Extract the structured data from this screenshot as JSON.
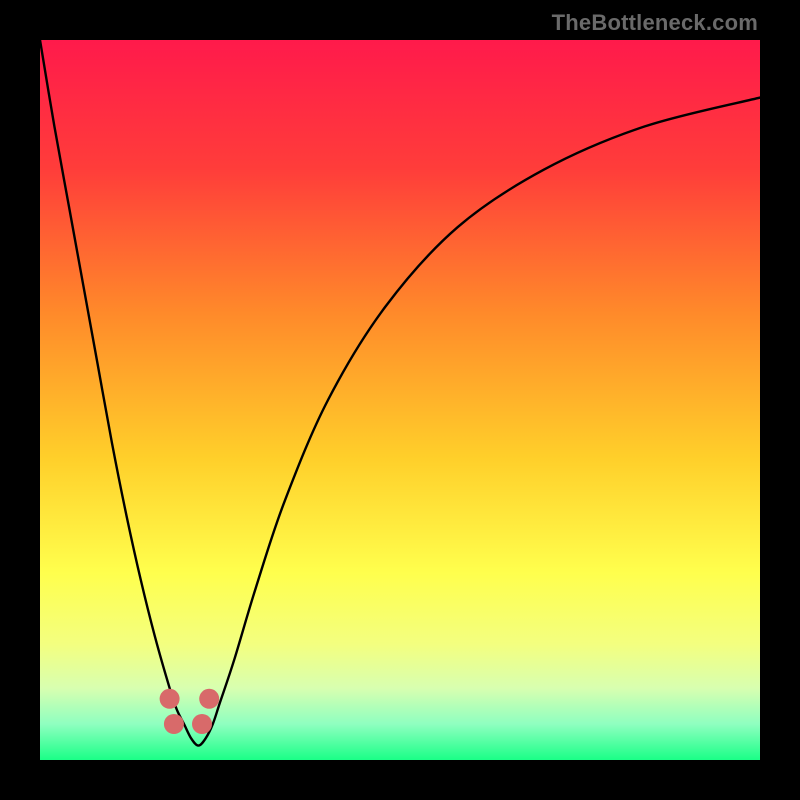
{
  "watermark": "TheBottleneck.com",
  "chart_data": {
    "type": "line",
    "title": "",
    "xlabel": "",
    "ylabel": "",
    "xlim": [
      0,
      100
    ],
    "ylim": [
      0,
      100
    ],
    "legend": false,
    "grid": false,
    "background_gradient_stops": [
      {
        "pct": 0,
        "color": "#ff1a4b"
      },
      {
        "pct": 18,
        "color": "#ff3d3a"
      },
      {
        "pct": 38,
        "color": "#ff8a2a"
      },
      {
        "pct": 58,
        "color": "#ffcf2a"
      },
      {
        "pct": 74,
        "color": "#ffff4d"
      },
      {
        "pct": 84,
        "color": "#f3ff80"
      },
      {
        "pct": 90,
        "color": "#d8ffb0"
      },
      {
        "pct": 95,
        "color": "#8fffc0"
      },
      {
        "pct": 100,
        "color": "#1aff87"
      }
    ],
    "series": [
      {
        "name": "bottleneck-curve",
        "x": [
          0,
          2,
          4,
          6,
          8,
          10,
          12,
          14,
          16,
          18,
          19,
          20,
          21,
          22,
          23,
          24,
          25,
          27,
          30,
          34,
          40,
          48,
          58,
          70,
          84,
          100
        ],
        "y": [
          100,
          88,
          77,
          66,
          55,
          44,
          34,
          25,
          17,
          10,
          7,
          5,
          3,
          2,
          3,
          5,
          8,
          14,
          24,
          36,
          50,
          63,
          74,
          82,
          88,
          92
        ]
      }
    ],
    "markers": [
      {
        "x": 18.0,
        "y": 8.5,
        "color": "#d86a6a",
        "r": 10
      },
      {
        "x": 18.6,
        "y": 5.0,
        "color": "#d86a6a",
        "r": 10
      },
      {
        "x": 22.5,
        "y": 5.0,
        "color": "#d86a6a",
        "r": 10
      },
      {
        "x": 23.5,
        "y": 8.5,
        "color": "#d86a6a",
        "r": 10
      }
    ]
  }
}
